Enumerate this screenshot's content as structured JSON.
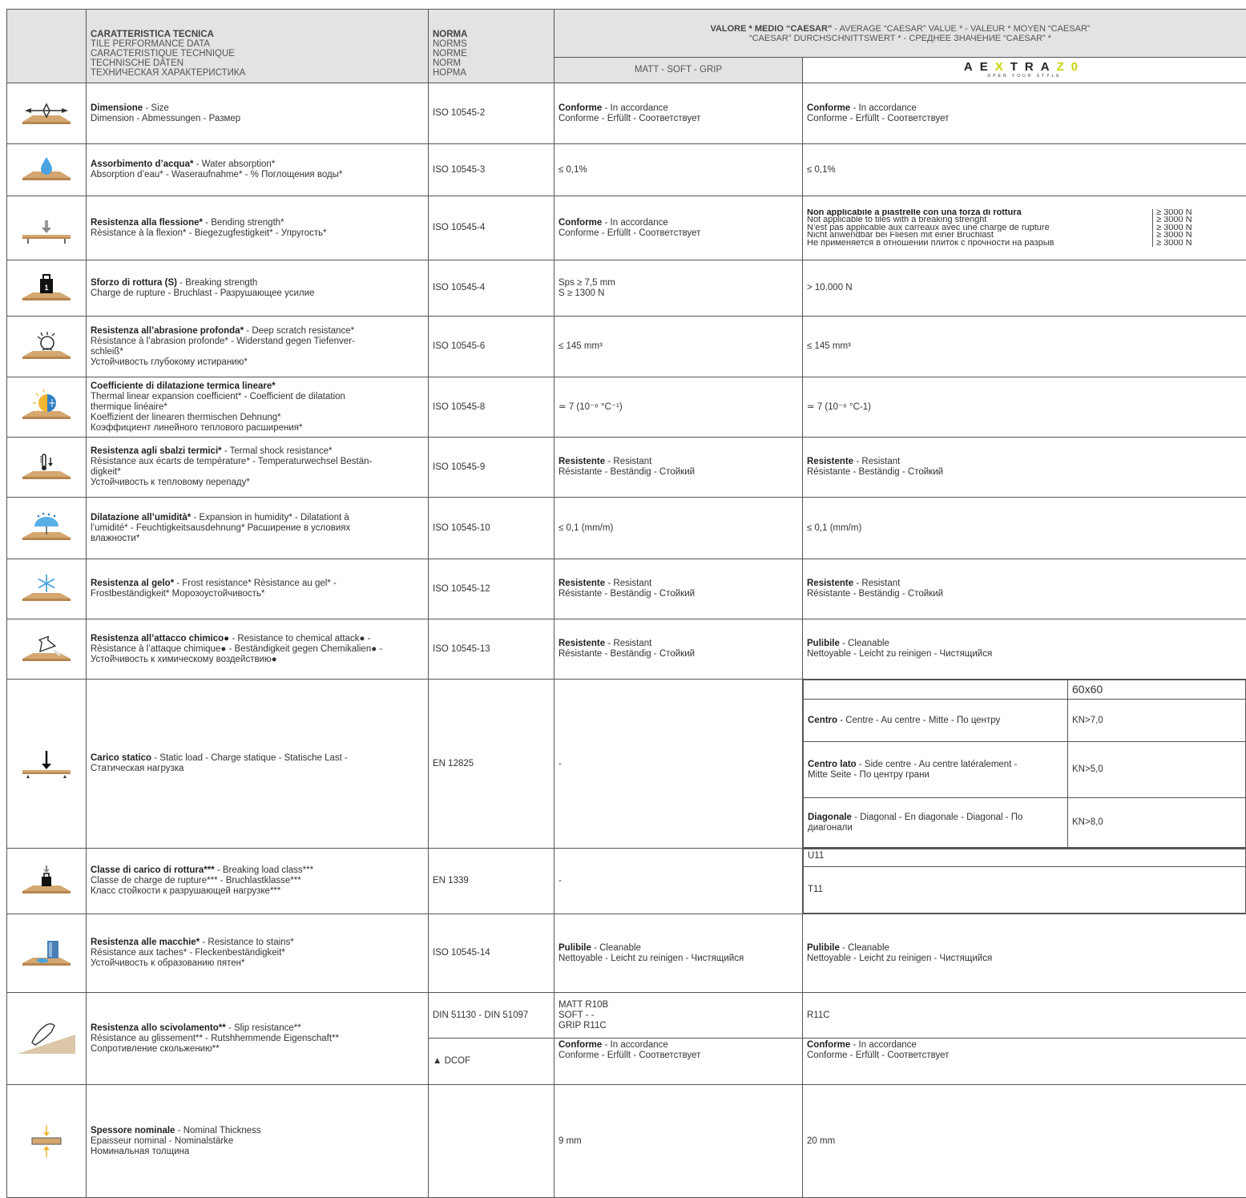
{
  "header": {
    "char_lines": [
      "CARATTERISTICA TECNICA",
      "TILE PERFORMANCE DATA",
      "CARACTERISTIQUE TECHNIQUE",
      "TECHNISCHE DATEN",
      "ТЕХНИЧЕСКАЯ ХАРАКТЕРИСТИКА"
    ],
    "norm_lines": [
      "NORMA",
      "NORMS",
      "NORME",
      "NORM",
      "НОРМА"
    ],
    "value_bold": "VALORE * MEDIO “CAESAR”",
    "value_rest": " - AVERAGE “CAESAR” VALUE * - VALEUR * MOYEN “CAESAR”",
    "value_line2": "“CAESAR” DURCHSCHNITTSWERT * - СРЕДНЕЕ ЗНАЧЕНИЕ “CAESAR” *",
    "col_standard": "MATT - SOFT - GRIP",
    "logo_a": "AE",
    "logo_x": "X",
    "logo_b": "TRA",
    "logo_z": "Z0",
    "logo_tag": "OPEN YOUR STYLE"
  },
  "rows": {
    "dim": {
      "icon": "dimension-arrows-icon",
      "t_b": "Dimensione",
      "t_r": " - Size",
      "t_2": "Dimension - Abmessungen - Размер",
      "norm": "ISO 10545-2",
      "v1_b": "Conforme",
      "v1_r": " - In accordance",
      "v1_2": "Conforme - Erfüllt - Соответствует",
      "v2_b": "Conforme",
      "v2_r": " - In accordance",
      "v2_2": "Conforme - Erfüllt - Соответствует"
    },
    "water": {
      "icon": "water-drop-icon",
      "t_b": "Assorbimento d’acqua*",
      "t_r": " - Water absorption*",
      "t_2": "Absorption d’eau* - Waseraufnahme* - % Поглощения воды*",
      "norm": "ISO 10545-3",
      "v1": "≤ 0,1%",
      "v2": "≤ 0,1%"
    },
    "bend": {
      "icon": "bending-arrow-icon",
      "t_b": "Resistenza alla flessione*",
      "t_r": " - Bending strength*",
      "t_2": "Rèsistance à la flexion* - Biegezugfestigkeit* - Упругость*",
      "norm": "ISO 10545-4",
      "v1_b": "Conforme",
      "v1_r": " - In accordance",
      "v1_2": "Conforme - Erfüllt - Соответствует",
      "v2_lines": [
        "Non applicabile a piastrelle con una forza di rottura",
        "Not applicable to tiles with a breaking strenght",
        "N’est pas applicable aux carreaux avec une charge de rupture",
        "Nicht anwendbar bei Fliesen mit einer Bruchlast",
        "Не применяется в отношении плиток с прочности на разрыв"
      ],
      "v2_vals": [
        "≥ 3000 N",
        "≥ 3000 N",
        "≥ 3000 N",
        "≥ 3000 N",
        "≥ 3000 N"
      ]
    },
    "break": {
      "icon": "weight-icon",
      "t_b": "Sforzo di rottura (S)",
      "t_r": " - Breaking strength",
      "t_2": "Charge de rupture - Bruchlast - Разрушающее усилие",
      "norm": "ISO 10545-4",
      "v1_1": "Sps ≥ 7,5 mm",
      "v1_2": "S ≥ 1300 N",
      "v2": "> 10.000 N"
    },
    "abr": {
      "icon": "abrasion-wheel-icon",
      "t_b": "Resistenza all’abrasione profonda*",
      "t_r": " - Deep scratch resistance*",
      "t_2": "Rèsistance à l’abrasion profonde* - Widerstand gegen Tiefenver-",
      "t_3": "schleiß*",
      "t_4": "Устойчивость глубокому истиранию*",
      "norm": "ISO 10545-6",
      "v1": "≤ 145 mm³",
      "v2": "≤ 145 mm³"
    },
    "therm": {
      "icon": "sun-snow-icon",
      "t_b": "Coefficiente di dilatazione termica lineare*",
      "t_2": "Thermal linear expansion coefficient* - Coefficient de dilatation",
      "t_3": "thermique linéaire*",
      "t_4": "Koeffizient der linearen thermischen Dehnung*",
      "t_5": "Коэффициент линейного теплового расширения*",
      "norm": "ISO 10545-8",
      "v1": "≃ 7 (10⁻⁶ °C⁻¹)",
      "v2": "≃ 7 (10⁻⁶ °C-1)"
    },
    "shock": {
      "icon": "thermometer-icon",
      "t_b": "Resistenza agli sbalzi termici*",
      "t_r": " - Termal shock resistance*",
      "t_2": "Rèsistance aux écarts de température* - Temperaturwechsel Bestän-",
      "t_3": "digkeit*",
      "t_4": "Устойчивость к тепловому перепаду*",
      "norm": "ISO 10545-9",
      "v1_b": "Resistente",
      "v1_r": " - Resistant",
      "v1_2": "Résistante - Beständig - Стойкий",
      "v2_b": "Resistente",
      "v2_r": " - Resistant",
      "v2_2": "Résistante - Beständig - Стойкий"
    },
    "humid": {
      "icon": "umbrella-rain-icon",
      "t_b": "Dilatazione all’umidità*",
      "t_r": " - Expansion in humidity* - Dilatationt à",
      "t_2": "l’umidité* - Feuchtigkeitsausdehnung* Расширение в условиях",
      "t_3": "влажности*",
      "norm": "ISO 10545-10",
      "v1": "≤  0,1 (mm/m)",
      "v2": "≤ 0,1 (mm/m)"
    },
    "frost": {
      "icon": "snowflake-icon",
      "t_b": "Resistenza al gelo*",
      "t_r": " - Frost resistance* Rèsistance au gel* -",
      "t_2": "Frostbeständigkeit* Морозоустойчивость*",
      "norm": "ISO 10545-12",
      "v1_b": "Resistente",
      "v1_r": " - Resistant",
      "v1_2": "Résistante - Beständig - Стойкий",
      "v2_b": "Resistente",
      "v2_r": " - Resistant",
      "v2_2": "Résistante - Beständig - Стойкий"
    },
    "chem": {
      "icon": "chemical-flask-icon",
      "t_b": "Resistenza all’attacco chimico●",
      "t_r": " - Resistance to chemical attack● -",
      "t_2": "Rèsistance à l’attaque chimique● - Beständigkeit gegen Chemikalien● -",
      "t_3": "Устойчивость к химическому воздействию●",
      "norm": "ISO 10545-13",
      "v1_b": "Resistente",
      "v1_r": " - Resistant",
      "v1_2": "Résistante - Beständig - Стойкий",
      "v2_b": "Pulibile",
      "v2_r": " - Cleanable",
      "v2_2": "Nettoyable - Leicht zu reinigen - Чистящийся"
    },
    "static": {
      "icon": "static-load-arrow-icon",
      "t_b": "Carico statico",
      "t_r": " - Static load - Charge statique - Statische Last -",
      "t_2": "Статическая нагрузка",
      "norm": "EN 12825",
      "v1": "-",
      "size": "60x60",
      "c1_b": "Centro",
      "c1_r": " - Centre - Au centre - Mitte - По центру",
      "c1_v": "KN>7,0",
      "c2_b": "Centro lato",
      "c2_r": " - Side centre - Au centre latéralement -",
      "c2_2": "Mitte Seite - По центру грани",
      "c2_v": "KN>5,0",
      "c3_b": "Diagonale",
      "c3_r": " - Diagonal - En diagonale - Diagonal - По",
      "c3_2": "диагонали",
      "c3_v": "KN>8,0"
    },
    "bclass": {
      "icon": "load-class-icon",
      "t_b": "Classe di carico di rottura***",
      "t_r": " - Breaking load class***",
      "t_2": "Classe de charge de rupture*** - Bruchlastklasse***",
      "t_3": "Класс стойкости к разрушающей нагрузке***",
      "norm": "EN 1339",
      "v1": "-",
      "v2_1": "U11",
      "v2_2": "T11"
    },
    "stain": {
      "icon": "stain-bucket-icon",
      "t_b": "Resistenza alle macchie*",
      "t_r": " - Resistance to stains*",
      "t_2": "Résistance aux taches* - Fleckenbeständigkeit*",
      "t_3": "Устойчивость к образованию пятен*",
      "norm": "ISO 10545-14",
      "v1_b": "Pulibile",
      "v1_r": " - Cleanable",
      "v1_2": "Nettoyable - Leicht zu reinigen - Чистящийся",
      "v2_b": "Pulibile",
      "v2_r": " - Cleanable",
      "v2_2": "Nettoyable - Leicht zu reinigen - Чистящийся"
    },
    "slip": {
      "icon": "shoe-slip-icon",
      "t_b": "Resistenza allo scivolamento**",
      "t_r": " - Slip resistance**",
      "t_2": "Résistance au glissement** - Rutshhemmende Eigenschaft**",
      "t_3": "Сопротивление скольжению**",
      "norm1": "DIN 51130 - DIN 51097",
      "norm2": "▲  DCOF",
      "v1_1": "MATT R10B",
      "v1_2": "SOFT - -",
      "v1_3": "GRIP R11C",
      "v2": "R11C",
      "v3_b": "Conforme",
      "v3_r": " - In accordance",
      "v3_2": "Conforme - Erfüllt - Соответствует",
      "v4_b": "Conforme",
      "v4_r": " - In accordance",
      "v4_2": "Conforme - Erfüllt - Соответствует"
    },
    "thick": {
      "icon": "thickness-arrows-icon",
      "t_b": "Spessore nominale",
      "t_r": " - Nominal Thickness",
      "t_2": "Epaisseur nominal - Nominalstärke",
      "t_3": "Номинальная толщина",
      "v1": "9 mm",
      "v2": "20 mm"
    }
  }
}
